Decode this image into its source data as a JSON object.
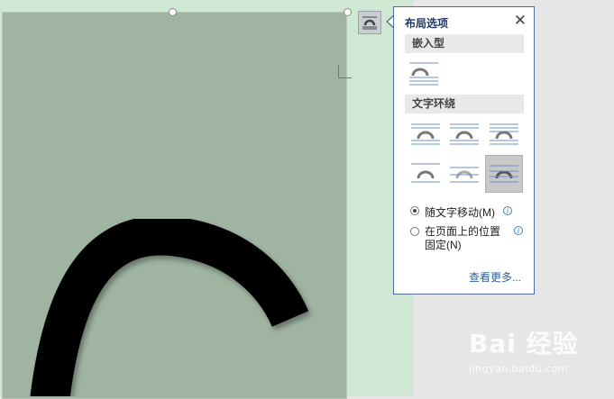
{
  "panel": {
    "title": "布局选项",
    "close_glyph": "✕",
    "inline_section": "嵌入型",
    "wrap_section": "文字环绕",
    "move_with_text": "随文字移动(M)",
    "fix_position_line1": "在页面上的位置",
    "fix_position_line2": "固定(N)",
    "see_more": "查看更多...",
    "info_glyph": "i"
  },
  "radio_state": {
    "move_with_text": true,
    "fix_position": false
  },
  "selected_wrap_option": "behind-text",
  "icons": [
    "layout-options-icon",
    "close-icon",
    "inline-with-text-icon",
    "square-wrap-icon",
    "tight-wrap-icon",
    "through-wrap-icon",
    "top-bottom-wrap-icon",
    "behind-text-icon",
    "in-front-of-text-icon",
    "info-icon"
  ],
  "watermark": {
    "brand": "Bai 经验",
    "url": "jingyan.baidu.com"
  },
  "colors": {
    "accent": "#1f3864",
    "link": "#2e5f99",
    "image_fill": "#9fb5a1",
    "page_bg": "#cfe8d4"
  }
}
